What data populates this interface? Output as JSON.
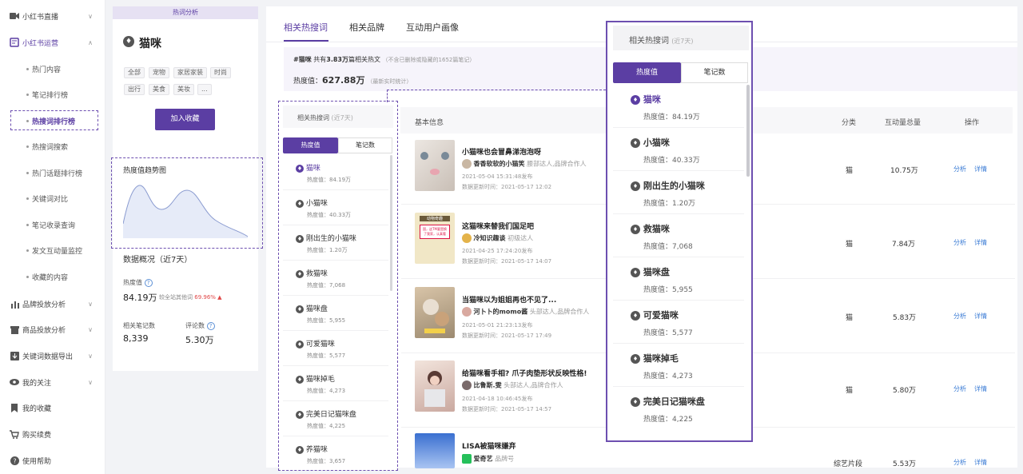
{
  "sidebar": {
    "sections": [
      {
        "label": "小红书直播",
        "icon": "video-icon",
        "arrow": "∨"
      },
      {
        "label": "小红书运营",
        "icon": "book-icon",
        "arrow": "∧"
      },
      {
        "label": "品牌投放分析",
        "icon": "chart-icon",
        "arrow": "∨"
      },
      {
        "label": "商品投放分析",
        "icon": "store-icon",
        "arrow": "∨"
      },
      {
        "label": "关键词数据导出",
        "icon": "download-icon",
        "arrow": "∨"
      },
      {
        "label": "我的关注",
        "icon": "eye-icon",
        "arrow": "∨"
      },
      {
        "label": "我的收藏",
        "icon": "bookmark-icon",
        "arrow": ""
      },
      {
        "label": "购买续费",
        "icon": "cart-icon",
        "arrow": ""
      },
      {
        "label": "使用帮助",
        "icon": "help-icon",
        "arrow": ""
      }
    ],
    "sub_items": [
      "热门内容",
      "笔记排行榜",
      "热搜词排行榜",
      "热搜词搜索",
      "热门话题排行榜",
      "关键词对比",
      "笔记收录查询",
      "发文互动量监控",
      "收藏的内容"
    ]
  },
  "keyword_panel": {
    "header": "热词分析",
    "keyword": "猫咪",
    "tags_row1": [
      "全部",
      "宠物",
      "家居家装",
      "时尚"
    ],
    "tags_row2": [
      "出行",
      "美食",
      "美妆",
      "..."
    ],
    "add_button": "加入收藏",
    "trend_title": "热度值趋势图",
    "overview_title": "数据概况（近7天）",
    "heat_label": "热度值",
    "heat_value": "84.19万",
    "heat_compare": "较全站其他词",
    "heat_pct": "69.96%",
    "notes_label": "相关笔记数",
    "notes_value": "8,339",
    "comments_label": "评论数",
    "comments_value": "5.30万"
  },
  "tabs": [
    "相关热搜词",
    "相关品牌",
    "互动用户画像"
  ],
  "summary": {
    "keyword": "#猫咪",
    "text1": "共有",
    "count": "3.83万",
    "text2": "篇相关热文",
    "note": "（不含已删除或隐藏的1652篇笔记）",
    "heat_label": "热度值：",
    "heat_value": "627.88万",
    "heat_note": "（最新实时统计）"
  },
  "small_list": {
    "title": "相关热搜词",
    "period": "(近7天)",
    "tab_active": "热度值",
    "tab_other": "笔记数",
    "value_prefix": "热度值：",
    "items": [
      {
        "name": "猫咪",
        "value": "84.19万"
      },
      {
        "name": "小猫咪",
        "value": "40.33万"
      },
      {
        "name": "刚出生的小猫咪",
        "value": "1.20万"
      },
      {
        "name": "救猫咪",
        "value": "7,068"
      },
      {
        "name": "猫咪盘",
        "value": "5,955"
      },
      {
        "name": "可爱猫咪",
        "value": "5,577"
      },
      {
        "name": "猫咪掉毛",
        "value": "4,273"
      },
      {
        "name": "完美日记猫咪盘",
        "value": "4,225"
      },
      {
        "name": "养猫咪",
        "value": "3,657"
      }
    ]
  },
  "table": {
    "headers": {
      "basic": "基本信息",
      "category": "分类",
      "interaction": "互动量总量",
      "action": "操作"
    },
    "action1": "分析",
    "action2": "详情",
    "rows": [
      {
        "title": "小猫咪也会冒鼻涕泡泡呀",
        "author": "香香软软的小猫笑",
        "tag": "腰部达人,品牌合作人",
        "published": "2021-05-04 15:31:48发布",
        "updated": "数据更新时间：2021-05-17 12:02",
        "category": "猫",
        "interaction": "10.75万"
      },
      {
        "title": "这猫咪来替我们国足吧",
        "author": "冷知识趣谈",
        "tag": "初级达人",
        "published": "2021-04-25 17:24:20发布",
        "updated": "数据更新时间：2021-05-17 14:07",
        "category": "猫",
        "interaction": "7.84万"
      },
      {
        "title": "当猫咪以为姐姐再也不见了...",
        "author": "河卜卜的momo酱",
        "tag": "头部达人,品牌合作人",
        "published": "2021-05-01 21:23:13发布",
        "updated": "数据更新时间：2021-05-17 17:49",
        "category": "猫",
        "interaction": "5.83万"
      },
      {
        "title": "给猫咪看手相? 爪子肉垫形状反映性格!",
        "author": "比鲁斯.雯",
        "tag": "头部达人,品牌合作人",
        "published": "2021-04-18 10:46:45发布",
        "updated": "数据更新时间：2021-05-17 14:57",
        "category": "猫",
        "interaction": "5.80万"
      },
      {
        "title": "LISA被猫咪嫌弃",
        "author": "爱奇艺",
        "tag": "品牌号",
        "published": "",
        "updated": "",
        "category": "综艺片段",
        "interaction": "5.53万"
      }
    ]
  },
  "thumb_texts": {
    "t2_head": "动物奇趣",
    "t2_body": "国，这TM要是换了我家，认真看"
  },
  "popup": {
    "title": "相关热搜词",
    "period": "(近7天)",
    "tab_active": "热度值",
    "tab_other": "笔记数",
    "value_prefix": "热度值：",
    "items": [
      {
        "name": "猫咪",
        "value": "84.19万"
      },
      {
        "name": "小猫咪",
        "value": "40.33万"
      },
      {
        "name": "刚出生的小猫咪",
        "value": "1.20万"
      },
      {
        "name": "救猫咪",
        "value": "7,068"
      },
      {
        "name": "猫咪盘",
        "value": "5,955"
      },
      {
        "name": "可爱猫咪",
        "value": "5,577"
      },
      {
        "name": "猫咪掉毛",
        "value": "4,273"
      },
      {
        "name": "完美日记猫咪盘",
        "value": "4,225"
      }
    ]
  },
  "colors": {
    "accent": "#5b3ea3",
    "link": "#3a7bd5",
    "up": "#e04848"
  }
}
